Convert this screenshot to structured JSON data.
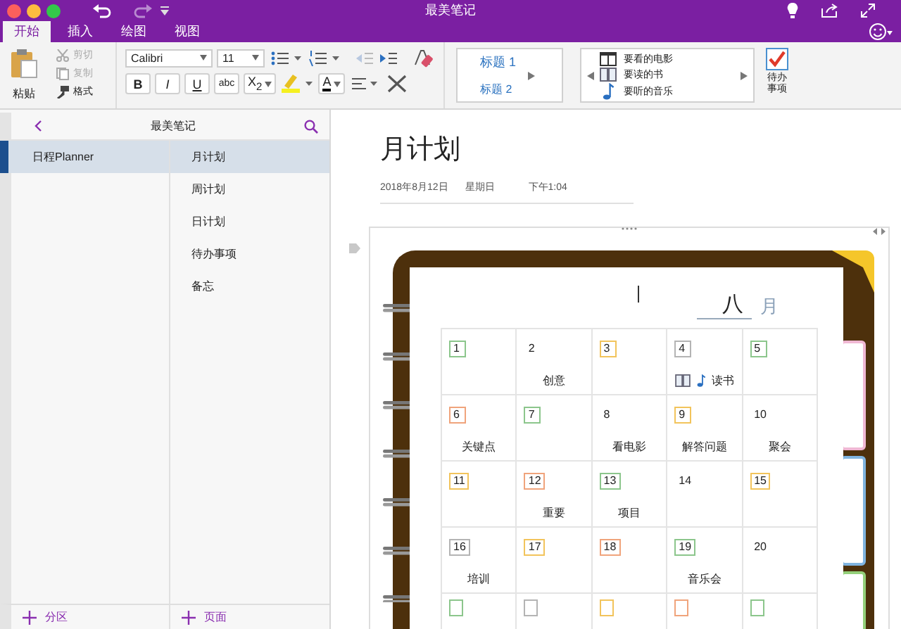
{
  "window": {
    "title": "最美笔记"
  },
  "tabs": [
    {
      "label": "开始",
      "selected": true
    },
    {
      "label": "插入",
      "selected": false
    },
    {
      "label": "绘图",
      "selected": false
    },
    {
      "label": "视图",
      "selected": false
    }
  ],
  "ribbon": {
    "paste": "粘贴",
    "clipboard": [
      {
        "label": "剪切",
        "kind": "cut",
        "disabled": true
      },
      {
        "label": "复制",
        "kind": "copy",
        "disabled": true
      },
      {
        "label": "格式",
        "kind": "format",
        "disabled": false
      }
    ],
    "font": {
      "name": "Calibri",
      "size": "11"
    },
    "format_buttons": [
      {
        "label": "B",
        "kind": "bold"
      },
      {
        "label": "I",
        "kind": "italic"
      },
      {
        "label": "U",
        "kind": "underline"
      },
      {
        "label": "abc",
        "kind": "strike"
      },
      {
        "label": "X$_{2}$",
        "kind": "subscript"
      }
    ],
    "font_color_label": "A",
    "styles": [
      "标题 1",
      "标题 2"
    ],
    "tags": [
      {
        "label": "要看的电影",
        "kind": "movie"
      },
      {
        "label": "要读的书",
        "kind": "book"
      },
      {
        "label": "要听的音乐",
        "kind": "music"
      }
    ],
    "todo": {
      "label": "待办事项",
      "checked": true
    }
  },
  "sidebar": {
    "notebook": "最美笔记",
    "sections": [
      {
        "label": "日程Planner",
        "selected": true
      }
    ],
    "pages": [
      {
        "label": "月计划",
        "selected": true
      },
      {
        "label": "周计划",
        "selected": false
      },
      {
        "label": "日计划",
        "selected": false
      },
      {
        "label": "待办事项",
        "selected": false
      },
      {
        "label": "备忘",
        "selected": false
      }
    ],
    "add_section": "分区",
    "add_page": "页面"
  },
  "page": {
    "title": "月计划",
    "date": "2018年8月12日",
    "weekday": "星期日",
    "time": "下午1:04",
    "calendar": {
      "month": "八",
      "month_suffix": "月",
      "rows": [
        [
          {
            "number": "1",
            "color": "#8cc68c"
          },
          {
            "number": "2",
            "text": "创意"
          },
          {
            "number": "3",
            "color": "#f2c45c"
          },
          {
            "number": "4",
            "color": "#b4b4b4",
            "tags": [
              {
                "kind": "book"
              },
              {
                "kind": "music"
              }
            ],
            "text": "读书"
          },
          {
            "number": "5",
            "color": "#8cc68c"
          }
        ],
        [
          {
            "number": "6",
            "color": "#f0a47c",
            "text": "关键点"
          },
          {
            "number": "7",
            "color": "#8cc68c"
          },
          {
            "number": "8",
            "text": "看电影"
          },
          {
            "number": "9",
            "color": "#f2c45c",
            "text": "解答问题"
          },
          {
            "number": "10",
            "text": "聚会"
          }
        ],
        [
          {
            "number": "11",
            "color": "#f2c45c"
          },
          {
            "number": "12",
            "color": "#f0a47c",
            "text": "重要"
          },
          {
            "number": "13",
            "color": "#8cc68c",
            "text": "项目"
          },
          {
            "number": "14"
          },
          {
            "number": "15",
            "color": "#f2c45c"
          }
        ],
        [
          {
            "number": "16",
            "color": "#b4b4b4",
            "text": "培训"
          },
          {
            "number": "17",
            "color": "#f2c45c"
          },
          {
            "number": "18",
            "color": "#f0a47c"
          },
          {
            "number": "19",
            "color": "#8cc68c",
            "text": "音乐会"
          },
          {
            "number": "20"
          }
        ],
        [
          {
            "color": "#8cc68c"
          },
          {
            "color": "#b4b4b4"
          },
          {
            "color": "#f2c45c"
          },
          {
            "color": "#f0a47c"
          },
          {
            "color": "#8cc68c"
          }
        ]
      ]
    }
  }
}
